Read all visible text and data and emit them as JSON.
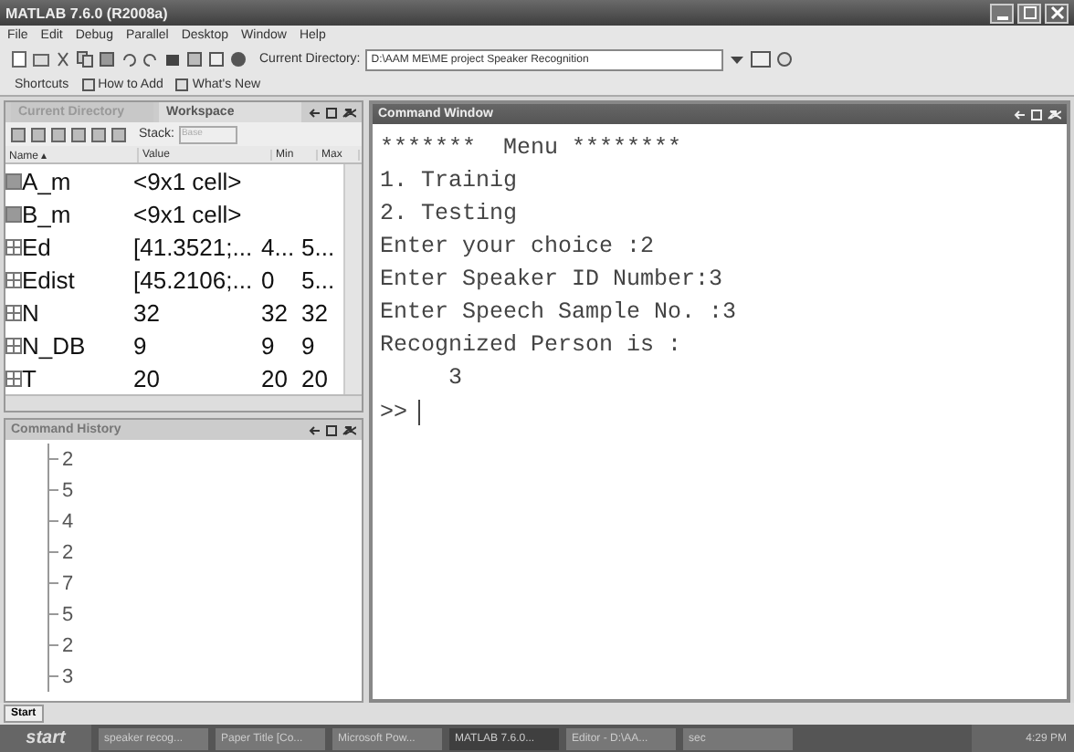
{
  "window": {
    "title": "MATLAB 7.6.0 (R2008a)"
  },
  "menu": [
    "File",
    "Edit",
    "Debug",
    "Parallel",
    "Desktop",
    "Window",
    "Help"
  ],
  "toolbar": {
    "current_directory_label": "Current Directory:",
    "current_directory": "D:\\AAM ME\\ME project Speaker Recognition"
  },
  "shortcuts": [
    {
      "label": "Shortcuts",
      "kind": "plain"
    },
    {
      "label": "How to Add",
      "kind": "icon"
    },
    {
      "label": "What's New",
      "kind": "icon"
    }
  ],
  "left_tabs": [
    {
      "label": "Current Directory",
      "selected": false
    },
    {
      "label": "Workspace",
      "selected": true
    }
  ],
  "workspace": {
    "stack_label": "Stack:",
    "stack_value": "Base",
    "columns": [
      "Name ▴",
      "Value",
      "Min",
      "Max"
    ],
    "rows": [
      {
        "name": "A_m",
        "value": "<9x1 cell>",
        "min": "",
        "max": "",
        "kind": "cell"
      },
      {
        "name": "B_m",
        "value": "<9x1 cell>",
        "min": "",
        "max": "",
        "kind": "cell"
      },
      {
        "name": "Ed",
        "value": "[41.3521;...",
        "min": "4...",
        "max": "5...",
        "kind": "matrix"
      },
      {
        "name": "Edist",
        "value": "[45.2106;...",
        "min": "0",
        "max": "5...",
        "kind": "matrix"
      },
      {
        "name": "N",
        "value": "32",
        "min": "32",
        "max": "32",
        "kind": "matrix"
      },
      {
        "name": "N_DB",
        "value": "9",
        "min": "9",
        "max": "9",
        "kind": "matrix"
      },
      {
        "name": "T",
        "value": "20",
        "min": "20",
        "max": "20",
        "kind": "matrix"
      }
    ]
  },
  "command_history": {
    "title": "Command History",
    "entries": [
      "2",
      "5",
      "4",
      "2",
      "7",
      "5",
      "2",
      "3"
    ]
  },
  "command_window": {
    "title": "Command Window",
    "lines": [
      "*******  Menu ********",
      "1. Trainig",
      "2. Testing",
      "Enter your choice :2",
      "Enter Speaker ID Number:3",
      "Enter Speech Sample No. :3",
      "Recognized Person is :",
      "     3"
    ],
    "prompt": ">>"
  },
  "start_button": "Start",
  "taskbar": {
    "start": "start",
    "tasks": [
      {
        "label": "speaker recog...",
        "selected": false
      },
      {
        "label": "Paper Title [Co...",
        "selected": false
      },
      {
        "label": "Microsoft Pow...",
        "selected": false
      },
      {
        "label": "MATLAB 7.6.0...",
        "selected": true
      },
      {
        "label": "Editor - D:\\AA...",
        "selected": false
      },
      {
        "label": "sec",
        "selected": false
      }
    ],
    "clock": "4:29 PM"
  }
}
